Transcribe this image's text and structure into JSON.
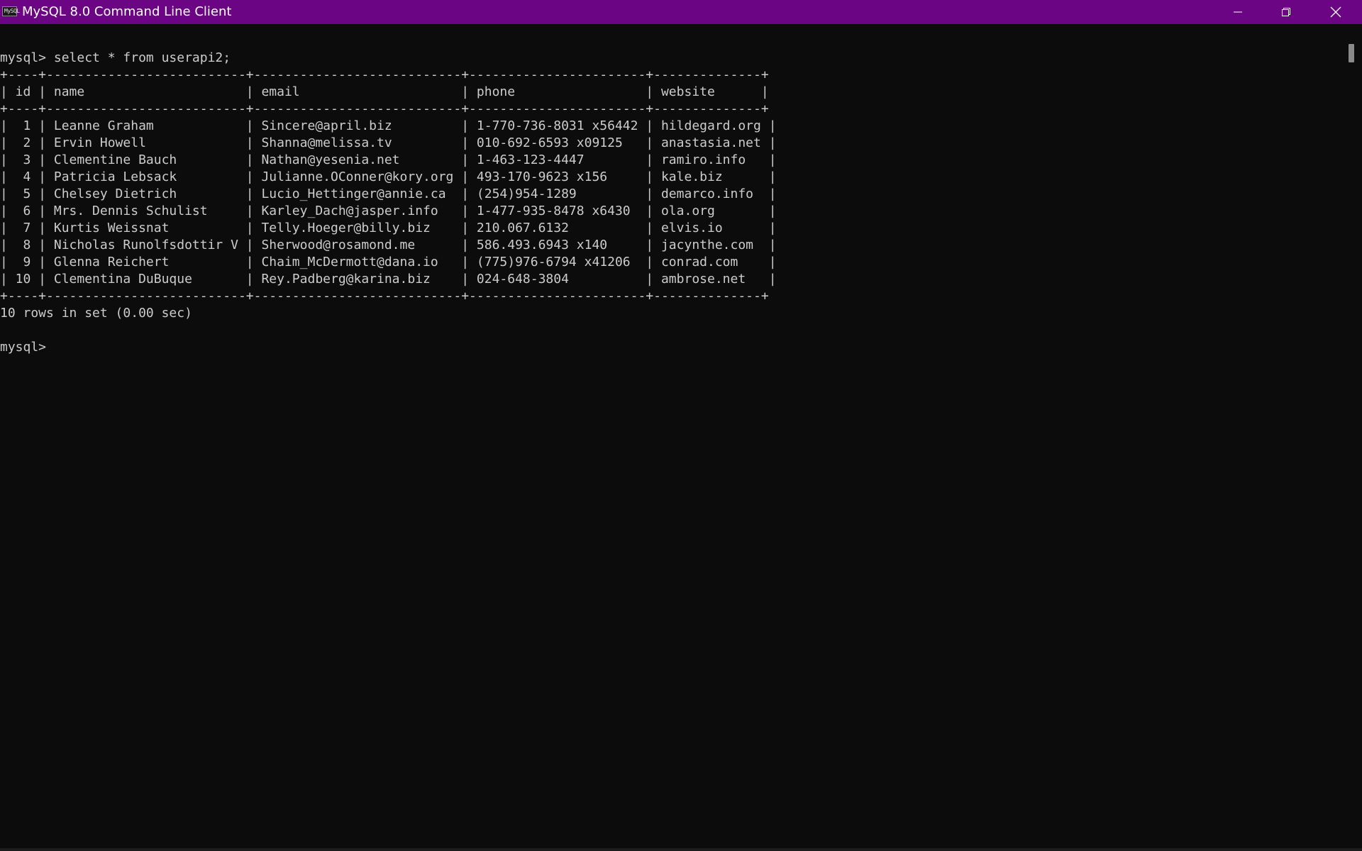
{
  "window": {
    "title": "MySQL 8.0 Command Line Client",
    "icon_text": "MySQL",
    "titlebar_color": "#6b0584",
    "controls": {
      "minimize_icon": "minimize-icon",
      "restore_icon": "restore-icon",
      "close_icon": "close-icon"
    }
  },
  "terminal": {
    "background": "#0c0c0c",
    "text_color": "#cccccc",
    "lines": [
      "mysql> select * from userapi2;",
      "+----+--------------------------+---------------------------+-----------------------+--------------+",
      "| id | name                     | email                     | phone                 | website      |",
      "+----+--------------------------+---------------------------+-----------------------+--------------+",
      "|  1 | Leanne Graham            | Sincere@april.biz         | 1-770-736-8031 x56442 | hildegard.org |",
      "|  2 | Ervin Howell             | Shanna@melissa.tv         | 010-692-6593 x09125   | anastasia.net |",
      "|  3 | Clementine Bauch         | Nathan@yesenia.net        | 1-463-123-4447        | ramiro.info   |",
      "|  4 | Patricia Lebsack         | Julianne.OConner@kory.org | 493-170-9623 x156     | kale.biz      |",
      "|  5 | Chelsey Dietrich         | Lucio_Hettinger@annie.ca  | (254)954-1289         | demarco.info  |",
      "|  6 | Mrs. Dennis Schulist     | Karley_Dach@jasper.info   | 1-477-935-8478 x6430  | ola.org       |",
      "|  7 | Kurtis Weissnat          | Telly.Hoeger@billy.biz    | 210.067.6132          | elvis.io      |",
      "|  8 | Nicholas Runolfsdottir V | Sherwood@rosamond.me      | 586.493.6943 x140     | jacynthe.com  |",
      "|  9 | Glenna Reichert          | Chaim_McDermott@dana.io   | (775)976-6794 x41206  | conrad.com    |",
      "| 10 | Clementina DuBuque       | Rey.Padberg@karina.biz    | 024-648-3804          | ambrose.net   |",
      "+----+--------------------------+---------------------------+-----------------------+--------------+",
      "10 rows in set (0.00 sec)",
      "",
      "mysql> "
    ]
  }
}
